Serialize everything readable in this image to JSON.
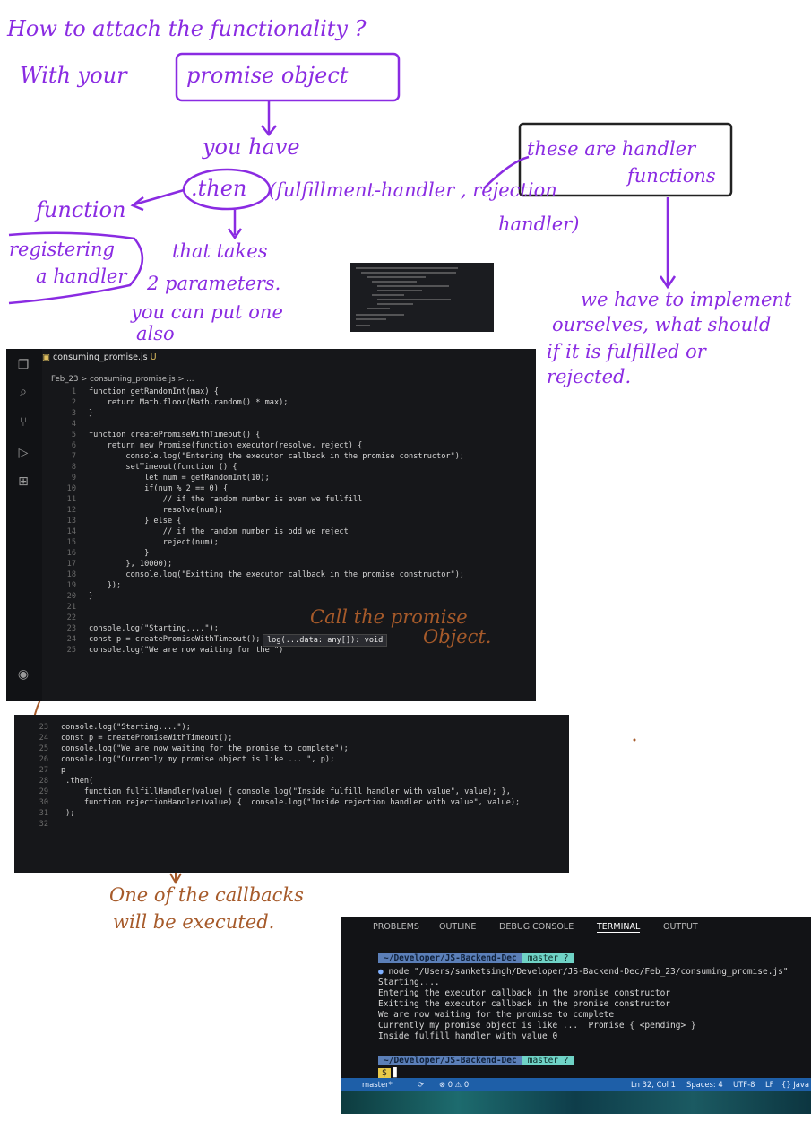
{
  "notes": {
    "line1": "How to attach the functionality ?",
    "with_your": "With your",
    "promise_object": "promise object",
    "you_have": "you have",
    "then": ".then",
    "then_args_1": "(fulfillment-handler , rejection",
    "then_args_2": "handler)",
    "these_are_1": "these are handler",
    "these_are_2": "functions",
    "function_label": "function",
    "registering_1": "registering",
    "registering_2": "a handler",
    "takes_1": "that takes",
    "takes_2": "2 parameters.",
    "takes_3": "you can put one",
    "takes_4": "also",
    "implement_1": "we have to implement",
    "implement_2": "ourselves, what should",
    "implement_3": "if it is fulfilled or",
    "implement_4": "rejected.",
    "call_promise_1": "Call the promise",
    "call_promise_2": "Object.",
    "callbacks_1": "One of the callbacks",
    "callbacks_2": "will be executed."
  },
  "editor": {
    "tab_title": "consuming_promise.js",
    "tab_status": "U",
    "breadcrumb": "Feb_23 > consuming_promise.js > ...",
    "hover_hint": "log(...data: any[]): void",
    "lines": [
      {
        "n": "1",
        "code": "function getRandomInt(max) {"
      },
      {
        "n": "2",
        "code": "    return Math.floor(Math.random() * max);"
      },
      {
        "n": "3",
        "code": "}"
      },
      {
        "n": "4",
        "code": ""
      },
      {
        "n": "5",
        "code": "function createPromiseWithTimeout() {"
      },
      {
        "n": "6",
        "code": "    return new Promise(function executor(resolve, reject) {"
      },
      {
        "n": "7",
        "code": "        console.log(\"Entering the executor callback in the promise constructor\");"
      },
      {
        "n": "8",
        "code": "        setTimeout(function () {"
      },
      {
        "n": "9",
        "code": "            let num = getRandomInt(10);"
      },
      {
        "n": "10",
        "code": "            if(num % 2 == 0) {"
      },
      {
        "n": "11",
        "code": "                // if the random number is even we fullfill"
      },
      {
        "n": "12",
        "code": "                resolve(num);"
      },
      {
        "n": "13",
        "code": "            } else {"
      },
      {
        "n": "14",
        "code": "                // if the random number is odd we reject"
      },
      {
        "n": "15",
        "code": "                reject(num);"
      },
      {
        "n": "16",
        "code": "            }"
      },
      {
        "n": "17",
        "code": "        }, 10000);"
      },
      {
        "n": "18",
        "code": "        console.log(\"Exitting the executor callback in the promise constructor\");"
      },
      {
        "n": "19",
        "code": "    });"
      },
      {
        "n": "20",
        "code": "}"
      },
      {
        "n": "21",
        "code": ""
      },
      {
        "n": "22",
        "code": ""
      },
      {
        "n": "23",
        "code": "console.log(\"Starting....\");"
      },
      {
        "n": "24",
        "code": "const p = createPromiseWithTimeout();"
      },
      {
        "n": "25",
        "code": "console.log(\"We are now waiting for the \")"
      }
    ]
  },
  "snippet": {
    "lines": [
      {
        "n": "23",
        "code": "console.log(\"Starting....\");"
      },
      {
        "n": "24",
        "code": "const p = createPromiseWithTimeout();"
      },
      {
        "n": "25",
        "code": "console.log(\"We are now waiting for the promise to complete\");"
      },
      {
        "n": "26",
        "code": "console.log(\"Currently my promise object is like ... \", p);"
      },
      {
        "n": "27",
        "code": "p"
      },
      {
        "n": "28",
        "code": " .then("
      },
      {
        "n": "29",
        "code": "     function fulfillHandler(value) { console.log(\"Inside fulfill handler with value\", value); },"
      },
      {
        "n": "30",
        "code": "     function rejectionHandler(value) {  console.log(\"Inside rejection handler with value\", value);"
      },
      {
        "n": "31",
        "code": " );"
      },
      {
        "n": "32",
        "code": ""
      }
    ]
  },
  "terminal": {
    "tabs": [
      "PROBLEMS",
      "OUTLINE",
      "DEBUG CONSOLE",
      "TERMINAL",
      "OUTPUT"
    ],
    "active_tab": "TERMINAL",
    "prompt_path": "~/Developer/JS-Backend-Dec",
    "prompt_git": "master ?",
    "command": "node \"/Users/sanketsingh/Developer/JS-Backend-Dec/Feb_23/consuming_promise.js\"",
    "output": [
      "Starting....",
      "Entering the executor callback in the promise constructor",
      "Exitting the executor callback in the promise constructor",
      "We are now waiting for the promise to complete",
      "Currently my promise object is like ...  Promise { <pending> }",
      "Inside fulfill handler with value 0"
    ],
    "status": {
      "branch": "master*",
      "problems": "0 ⚠ 0",
      "position": "Ln 32, Col 1",
      "spaces": "Spaces: 4",
      "encoding": "UTF-8",
      "eol": "LF",
      "lang": "{} Java"
    }
  },
  "colors": {
    "ink_purple": "#8a2be2",
    "ink_brown": "#a65a2a",
    "editor_bg": "#16171a",
    "status_bar": "#1e5fa8"
  }
}
